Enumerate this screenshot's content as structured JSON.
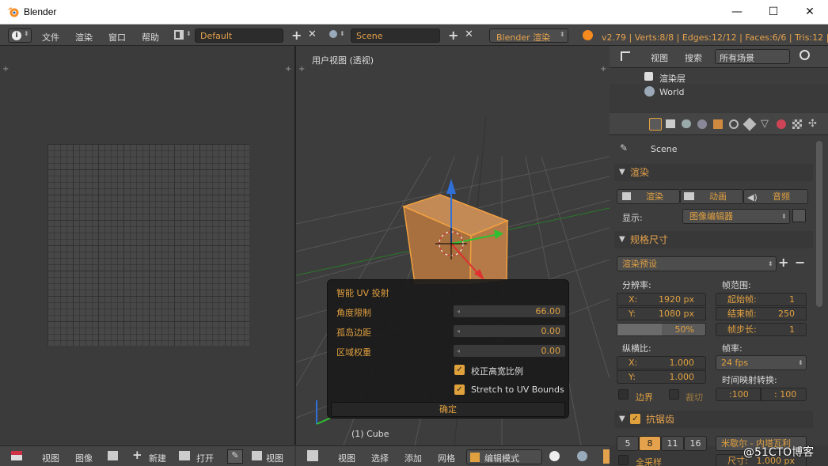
{
  "window": {
    "app_title": "Blender",
    "minimize": "—",
    "maximize": "☐",
    "close": "✕"
  },
  "menubar": {
    "info_icon": "i",
    "menus": [
      "文件",
      "渲染",
      "窗口",
      "帮助"
    ],
    "layout": "Default",
    "scene": "Scene",
    "engine": "Blender 渲染",
    "stats": "v2.79 | Verts:8/8 | Edges:12/12 | Faces:6/6 | Tris:12 | 内存"
  },
  "viewport": {
    "label": "用户视图 (透视)",
    "object_label": "(1) Cube"
  },
  "operator_panel": {
    "title": "智能 UV 投射",
    "rows": [
      {
        "label": "角度限制",
        "value": "66.00"
      },
      {
        "label": "孤岛边距",
        "value": "0.00"
      },
      {
        "label": "区域权重",
        "value": "0.00"
      }
    ],
    "check1": "校正高宽比例",
    "check2": "Stretch to UV Bounds",
    "ok": "确定"
  },
  "outliner": {
    "view": "视图",
    "search": "搜索",
    "filter": "所有场景",
    "render_layers": "渲染层",
    "world": "World"
  },
  "properties": {
    "scene_name": "Scene",
    "render_panel": "渲染",
    "render_btn": "渲染",
    "anim_btn": "动画",
    "audio_btn": "音频",
    "display_label": "显示:",
    "display_value": "图像编辑器",
    "dimensions_panel": "规格尺寸",
    "preset": "渲染预设",
    "res_label": "分辨率:",
    "res_x_label": "X:",
    "res_x": "1920 px",
    "res_y_label": "Y:",
    "res_y": "1080 px",
    "res_pct": "50%",
    "frame_label": "帧范围:",
    "start_label": "起始帧:",
    "start": "1",
    "end_label": "结束帧:",
    "end": "250",
    "step_label": "帧步长:",
    "step": "1",
    "aspect_label": "纵横比:",
    "asp_x": "1.000",
    "asp_y": "1.000",
    "fps_label": "帧率:",
    "fps": "24 fps",
    "remap_label": "时间映射转换:",
    "remap_old": ":100",
    "remap_new": ": 100",
    "border": "边界",
    "crop": "裁切",
    "aa_panel": "抗锯齿",
    "aa_values": [
      "5",
      "8",
      "11",
      "16"
    ],
    "filter_value": "米歇尔 - 内塔瓦利",
    "full_sample": "全采样",
    "size_label": "尺寸:",
    "size_value": "1.000 px"
  },
  "uv_bottom": {
    "view": "视图",
    "image": "图像",
    "new": "新建",
    "open": "打开",
    "view2": "视图"
  },
  "vp_bottom": {
    "view": "视图",
    "select": "选择",
    "add": "添加",
    "mesh": "网格",
    "mode": "编辑模式"
  },
  "watermark": "@51CTO博客",
  "colors": {
    "accent": "#e5a24d",
    "header": "#454545",
    "cube": "#b77a48"
  }
}
